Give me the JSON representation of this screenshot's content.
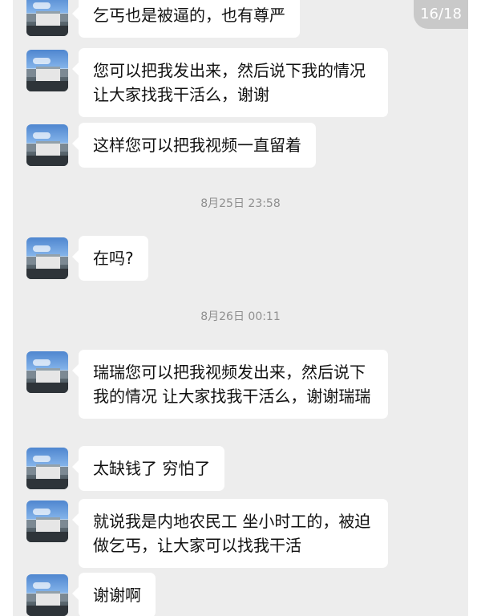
{
  "page_indicator": "16/18",
  "messages": [
    {
      "text": "乞丐也是被逼的，也有尊严"
    },
    {
      "text": "您可以把我发出来，然后说下我的情况 让大家找我干活么，谢谢"
    },
    {
      "text": "这样您可以把我视频一直留着"
    },
    {
      "text": "在吗?"
    },
    {
      "text": "瑞瑞您可以把我视频发出来，然后说下我的情况 让大家找我干活么，谢谢瑞瑞"
    },
    {
      "text": "太缺钱了 穷怕了"
    },
    {
      "text": "就说我是内地农民工 坐小时工的，被迫做乞丐，让大家可以找我干活"
    },
    {
      "text": "谢谢啊"
    }
  ],
  "timestamps": [
    "8月25日 23:58",
    "8月26日 00:11"
  ]
}
